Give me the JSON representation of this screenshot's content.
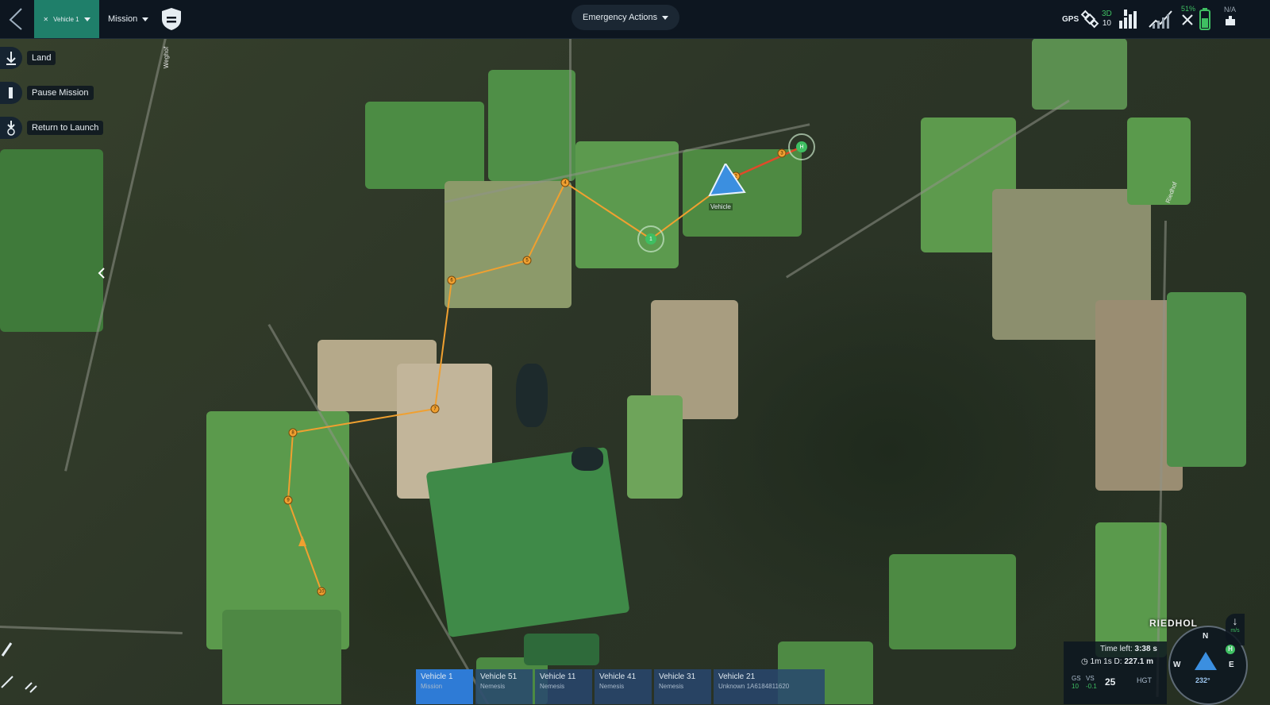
{
  "topbar": {
    "vehicle_label": "Vehicle 1",
    "mission_label": "Mission",
    "emergency_label": "Emergency Actions",
    "gps_label": "GPS",
    "gps_fix": "3D",
    "gps_sats": "10",
    "battery_pct": "51%",
    "na_label": "N/A"
  },
  "left_panel": {
    "land": "Land",
    "pause": "Pause Mission",
    "rtl": "Return to Launch"
  },
  "map": {
    "place_label": "RIEDHOL",
    "vehicle_marker_label": "Vehicle",
    "road_labels": [
      "Weghof",
      "Riedhof"
    ]
  },
  "mission_path": {
    "color": "#f0a030",
    "active_segment_color": "#e04a2a",
    "waypoints": [
      "1",
      "2",
      "3",
      "4",
      "5",
      "6",
      "7",
      "8",
      "9",
      "10"
    ]
  },
  "vehicle_tabs": [
    {
      "name": "Vehicle 1",
      "sub": "Mission",
      "active": true
    },
    {
      "name": "Vehicle 51",
      "sub": "Nemesis",
      "active": false
    },
    {
      "name": "Vehicle 11",
      "sub": "Nemesis",
      "active": false
    },
    {
      "name": "Vehicle 41",
      "sub": "Nemesis",
      "active": false
    },
    {
      "name": "Vehicle 31",
      "sub": "Nemesis",
      "active": false
    },
    {
      "name": "Vehicle 21",
      "sub": "Unknown 1A6184811620",
      "active": false
    }
  ],
  "telemetry": {
    "time_left_label": "Time left:",
    "time_left": "3:38 s",
    "elapsed": "1m 1s",
    "distance_label": "D:",
    "distance": "227.1 m",
    "gs_label": "GS",
    "gs_value": "10",
    "vs_label": "VS",
    "vs_value": "-0.1",
    "speed": "25",
    "hgt_label": "HGT"
  },
  "compass": {
    "n": "N",
    "e": "E",
    "w": "W",
    "heading": "232°",
    "home": "H",
    "unit": "m/s"
  }
}
